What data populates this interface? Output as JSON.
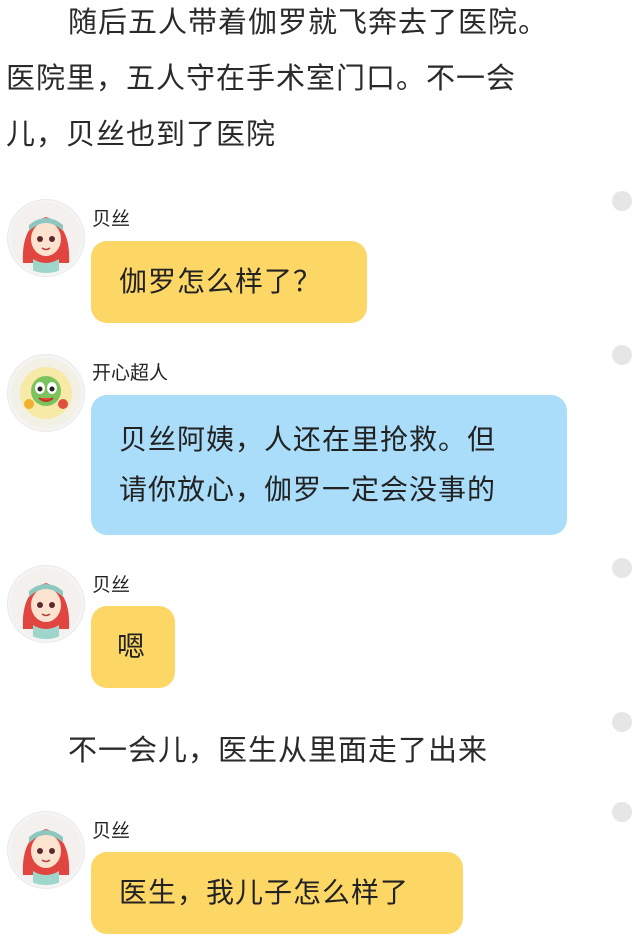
{
  "narration_1": {
    "lines": [
      "随后五人带着伽罗就飞奔去了医院。",
      "医院里，五人守在手术室门口。不一会",
      "儿，贝丝也到了医院"
    ]
  },
  "narration_2": {
    "text": "不一会儿，医生从里面走了出来"
  },
  "messages": [
    {
      "speaker": "贝丝",
      "lines": [
        "伽罗怎么样了？"
      ],
      "color": "#fdd765",
      "avatar": "beth-avatar"
    },
    {
      "speaker": "开心超人",
      "lines": [
        "贝丝阿姨，人还在里抢救。但",
        "请你放心，伽罗一定会没事的"
      ],
      "color": "#a9ddf9",
      "avatar": "happy-superman-avatar"
    },
    {
      "speaker": "贝丝",
      "lines": [
        "嗯"
      ],
      "color": "#fdd765",
      "avatar": "beth-avatar"
    },
    {
      "speaker": "贝丝",
      "lines": [
        "医生，我儿子怎么样了"
      ],
      "color": "#fdd765",
      "avatar": "beth-avatar"
    }
  ]
}
